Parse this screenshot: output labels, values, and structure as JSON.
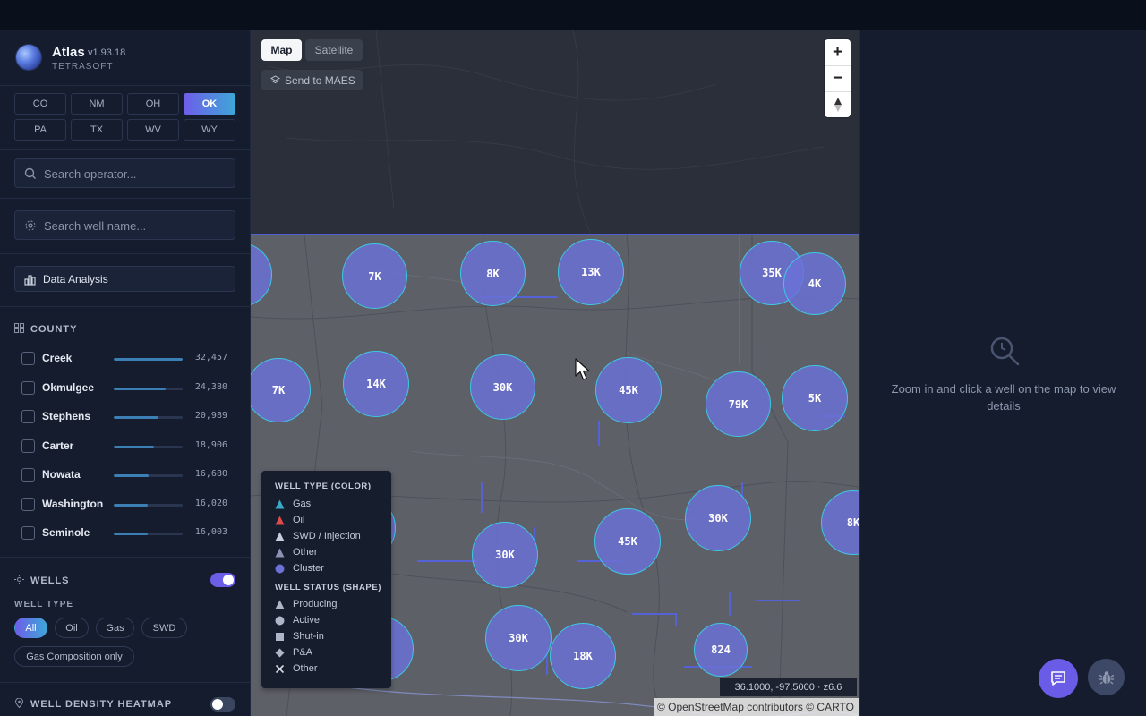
{
  "app": {
    "name": "Atlas",
    "version": "v1.93.18",
    "company": "TETRASOFT"
  },
  "states": [
    {
      "code": "CO",
      "active": false
    },
    {
      "code": "NM",
      "active": false
    },
    {
      "code": "OH",
      "active": false
    },
    {
      "code": "OK",
      "active": true
    },
    {
      "code": "PA",
      "active": false
    },
    {
      "code": "TX",
      "active": false
    },
    {
      "code": "WV",
      "active": false
    },
    {
      "code": "WY",
      "active": false
    }
  ],
  "search_operator": {
    "placeholder": "Search operator..."
  },
  "search_well": {
    "placeholder": "Search well name..."
  },
  "data_analysis": {
    "label": "Data Analysis"
  },
  "county": {
    "title": "COUNTY",
    "items": [
      {
        "name": "Creek",
        "count": "32,457",
        "fraction": 1.0
      },
      {
        "name": "Okmulgee",
        "count": "24,380",
        "fraction": 0.75
      },
      {
        "name": "Stephens",
        "count": "20,989",
        "fraction": 0.65
      },
      {
        "name": "Carter",
        "count": "18,906",
        "fraction": 0.58
      },
      {
        "name": "Nowata",
        "count": "16,680",
        "fraction": 0.51
      },
      {
        "name": "Washington",
        "count": "16,020",
        "fraction": 0.49
      },
      {
        "name": "Seminole",
        "count": "16,003",
        "fraction": 0.49
      }
    ]
  },
  "wells": {
    "title": "WELLS",
    "enabled": true,
    "well_type_label": "WELL TYPE",
    "types": [
      {
        "label": "All",
        "active": true
      },
      {
        "label": "Oil",
        "active": false
      },
      {
        "label": "Gas",
        "active": false
      },
      {
        "label": "SWD",
        "active": false
      },
      {
        "label": "Gas Composition only",
        "active": false
      }
    ]
  },
  "heatmap": {
    "title": "WELL DENSITY HEATMAP",
    "enabled": false
  },
  "map": {
    "tabs": [
      {
        "label": "Map",
        "active": true
      },
      {
        "label": "Satellite",
        "active": false
      }
    ],
    "send_label": "Send to MAES",
    "zoom_in": "+",
    "zoom_out": "−",
    "clusters": [
      "7K",
      "8K",
      "13K",
      "35K",
      "4K",
      "7K",
      "14K",
      "30K",
      "45K",
      "79K",
      "5K",
      "30K",
      "45K",
      "30K",
      "8K",
      "30K",
      "18K",
      "824"
    ],
    "coords": "36.1000, -97.5000 · z6.6",
    "attribution": "© OpenStreetMap contributors © CARTO",
    "cluster_color": "#6b71d6",
    "cluster_border": "#3ec7e6"
  },
  "legend": {
    "type_title": "WELL TYPE (COLOR)",
    "types": [
      {
        "label": "Gas",
        "color": "#3aa8c8",
        "icon": "triangle"
      },
      {
        "label": "Oil",
        "color": "#e04a4a",
        "icon": "triangle"
      },
      {
        "label": "SWD / Injection",
        "color": "#c7cee0",
        "icon": "triangle"
      },
      {
        "label": "Other",
        "color": "#8a93b0",
        "icon": "triangle"
      },
      {
        "label": "Cluster",
        "color": "#6b71d6",
        "icon": "circle"
      }
    ],
    "status_title": "WELL STATUS (SHAPE)",
    "statuses": [
      {
        "label": "Producing",
        "icon": "triangle"
      },
      {
        "label": "Active",
        "icon": "circle"
      },
      {
        "label": "Shut-in",
        "icon": "square"
      },
      {
        "label": "P&A",
        "icon": "diamond"
      },
      {
        "label": "Other",
        "icon": "x"
      }
    ]
  },
  "details": {
    "message": "Zoom in and click a well on the map to view details"
  }
}
